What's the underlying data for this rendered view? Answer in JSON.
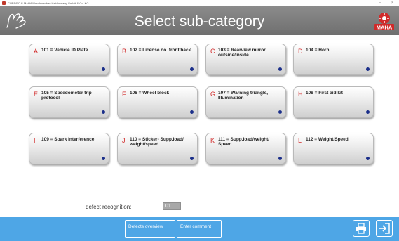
{
  "window": {
    "title": "CUBE/EC  © MAHA Maschinenbau Haldenwang GmbH & Co. KG",
    "controls": [
      "–",
      "×"
    ]
  },
  "header": {
    "title": "Select sub-category",
    "brand": "MAHA",
    "colors": {
      "bar": "#7a7a7a",
      "accent": "#d12a2a"
    }
  },
  "tiles": [
    {
      "letter": "A",
      "label": "101 = Vehicle ID Plate"
    },
    {
      "letter": "B",
      "label": "102 = License no. front/back"
    },
    {
      "letter": "C",
      "label": "103 = Rearview mirror outside/inside"
    },
    {
      "letter": "D",
      "label": "104 = Horn"
    },
    {
      "letter": "E",
      "label": "105 = Speedometer trip protocol"
    },
    {
      "letter": "F",
      "label": "106 = Wheel block"
    },
    {
      "letter": "G",
      "label": "107 = Warning triangle, Illumination"
    },
    {
      "letter": "H",
      "label": "108 = First aid kit"
    },
    {
      "letter": "I",
      "label": "109 = Spark interference"
    },
    {
      "letter": "J",
      "label": "110 = Sticker- Supp.load/ weight/speed"
    },
    {
      "letter": "K",
      "label": "111 = Supp.load/weight/ Speed"
    },
    {
      "letter": "L",
      "label": "112 = Weight/Speed"
    }
  ],
  "defect": {
    "label": "defect recognition:",
    "value": "01."
  },
  "footer": {
    "defects_overview": "Defects overview",
    "enter_comment": "Enter comment",
    "print_icon": "printer-icon",
    "exit_icon": "exit-icon",
    "color": "#4ea6e6"
  }
}
